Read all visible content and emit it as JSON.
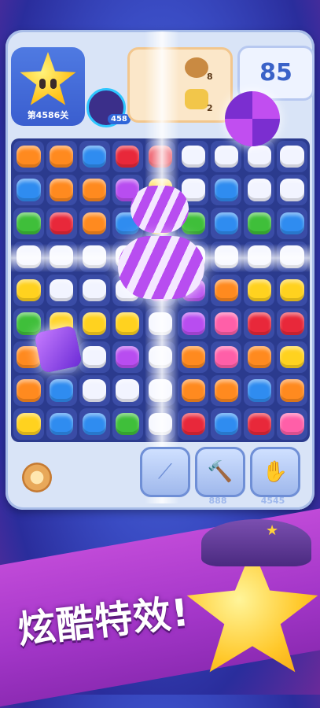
{
  "hud": {
    "level_label": "第4586关",
    "spinner_count": "458",
    "goals": [
      {
        "icon": "almond-candy-icon",
        "count": "8"
      },
      {
        "icon": "caramel-cube-icon",
        "count": "2"
      }
    ],
    "moves_left": "85"
  },
  "boosters": [
    {
      "icon": "magic-wand-icon",
      "count": ""
    },
    {
      "icon": "hammer-icon",
      "count": "888"
    },
    {
      "icon": "glove-icon",
      "count": "4545"
    }
  ],
  "banner": {
    "slogan": "炫酷特效!"
  },
  "board_colors": {
    "orange": "#ff8a1f",
    "red": "#e8283a",
    "blue": "#2f8cf0",
    "yellow": "#ffd21f",
    "green": "#3fbf3a",
    "purple": "#b84df0",
    "white": "#f2f4ff",
    "pink": "#ff5fa8"
  }
}
